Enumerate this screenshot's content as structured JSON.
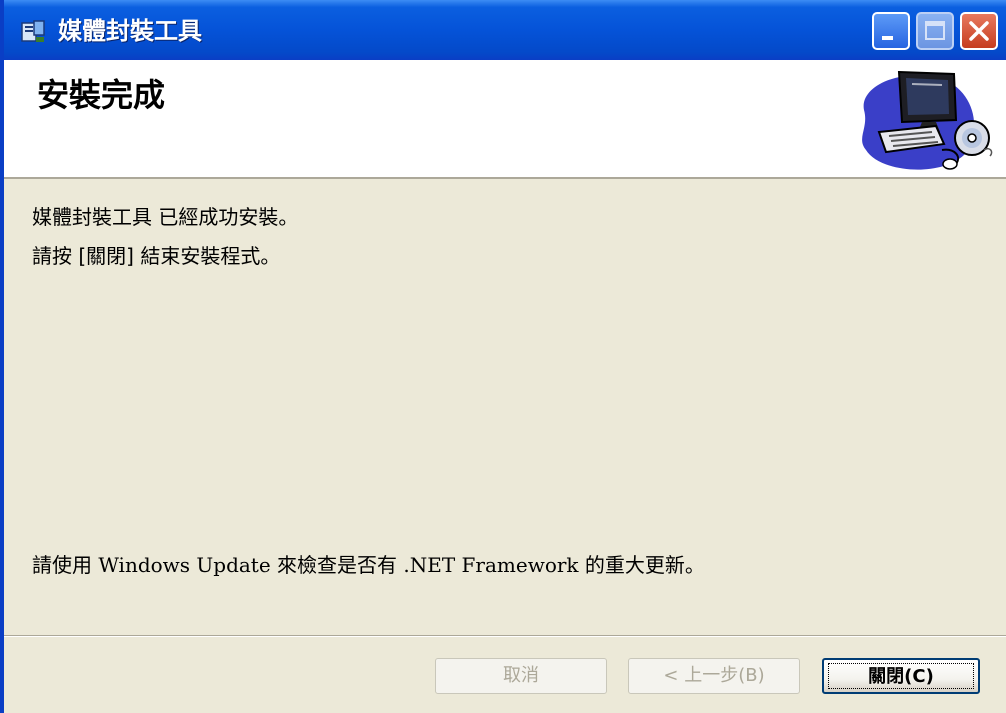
{
  "window": {
    "title": "媒體封裝工具"
  },
  "banner": {
    "title": "安裝完成",
    "art_icon": "computer-with-cd-icon"
  },
  "content": {
    "success_message": "媒體封裝工具 已經成功安裝。",
    "close_instruction": "請按 [關閉] 結束安裝程式。",
    "update_notice": "請使用 Windows Update 來檢查是否有 .NET Framework 的重大更新。"
  },
  "buttons": {
    "cancel_label": "取消",
    "back_label": "< 上一步(B)",
    "close_label": "關閉(C)"
  },
  "colors": {
    "titlebar": "#0553D8",
    "dialog_bg": "#ECE9D8",
    "close_button": "#C63D1F"
  }
}
